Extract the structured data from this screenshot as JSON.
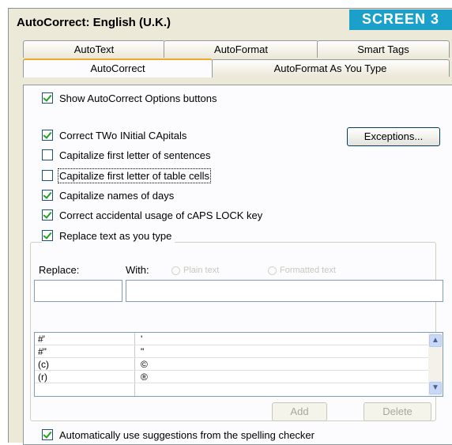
{
  "window": {
    "title": "AutoCorrect: English (U.K.)"
  },
  "badge": "SCREEN 3",
  "tabs": {
    "row1": [
      "AutoText",
      "AutoFormat",
      "Smart Tags"
    ],
    "row2": [
      "AutoCorrect",
      "AutoFormat As You Type"
    ]
  },
  "options": {
    "show_buttons": {
      "label": "Show AutoCorrect Options buttons",
      "checked": true
    },
    "two_initial": {
      "label": "Correct TWo INitial CApitals",
      "checked": true
    },
    "first_letter": {
      "label": "Capitalize first letter of sentences",
      "checked": false
    },
    "table_cells": {
      "label": "Capitalize first letter of table cells",
      "checked": false
    },
    "days": {
      "label": "Capitalize names of days",
      "checked": true
    },
    "caps_lock": {
      "label": "Correct accidental usage of cAPS LOCK key",
      "checked": true
    },
    "replace_text": {
      "label": "Replace text as you type",
      "checked": true
    },
    "spell_suggest": {
      "label": "Automatically use suggestions from the spelling checker",
      "checked": true
    }
  },
  "buttons": {
    "exceptions": "Exceptions...",
    "add": "Add",
    "delete": "Delete"
  },
  "replace": {
    "replace_label": "Replace:",
    "with_label": "With:",
    "plain_text": "Plain text",
    "formatted_text": "Formatted text",
    "replace_value": "",
    "with_value": ""
  },
  "entries": [
    {
      "replace": "#'",
      "with": "'"
    },
    {
      "replace": "#\"",
      "with": "\""
    },
    {
      "replace": "(c)",
      "with": "©"
    },
    {
      "replace": "(r)",
      "with": "®"
    }
  ],
  "icons": {
    "scroll_up": "chevron-up-icon",
    "scroll_down": "chevron-down-icon",
    "check": "checkmark-icon"
  }
}
